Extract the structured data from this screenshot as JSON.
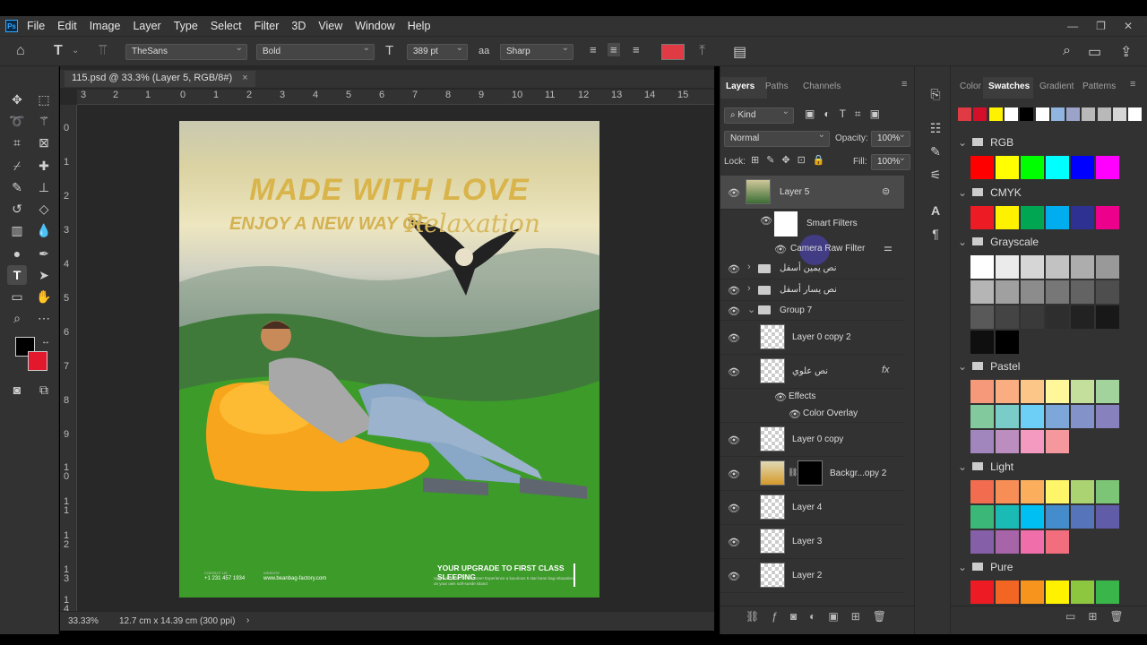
{
  "menu": {
    "logo": "Ps",
    "items": [
      "File",
      "Edit",
      "Image",
      "Layer",
      "Type",
      "Select",
      "Filter",
      "3D",
      "View",
      "Window",
      "Help"
    ]
  },
  "options": {
    "font_family": "TheSans",
    "font_style": "Bold",
    "font_size": "389 pt",
    "anti_alias_icon": "aa",
    "anti_alias": "Sharp",
    "text_color": "#e03a44"
  },
  "document": {
    "tab_title": "115.psd @ 33.3% (Layer 5, RGB/8#)",
    "ruler_h": [
      "3",
      "2",
      "1",
      "0",
      "1",
      "2",
      "3",
      "4",
      "5",
      "6",
      "7",
      "8",
      "9",
      "10",
      "11",
      "12",
      "13",
      "14",
      "15"
    ],
    "ruler_v": [
      "0",
      "1",
      "2",
      "3",
      "4",
      "5",
      "6",
      "7",
      "8",
      "9",
      "1 0",
      "1 1",
      "1 2",
      "1 3",
      "1 4"
    ],
    "zoom": "33.33%",
    "doc_size": "12.7 cm x 14.39 cm (300 ppi)"
  },
  "artwork": {
    "headline": "MADE WITH LOVE",
    "subline": "ENJOY A NEW WAY OF",
    "script_word": "Relaxation",
    "tagline": "YOUR UPGRADE TO FIRST CLASS SLEEPING",
    "blurb": "Upgrade your comfort zone! Experience a luxurious 5 star bean bag relaxation on your own soft-suede island",
    "contact_label": "CONTACT US",
    "phone": "+1 231 457 1934",
    "website_label": "WEBSITE",
    "website": "www.beanbag-factory.com"
  },
  "layers_panel": {
    "tabs": [
      "Layers",
      "Paths",
      "Channels"
    ],
    "kind": "Kind",
    "blend_mode": "Normal",
    "opacity_label": "Opacity:",
    "opacity": "100%",
    "lock_label": "Lock:",
    "fill_label": "Fill:",
    "fill": "100%",
    "layers": {
      "layer5": "Layer 5",
      "smart_filters": "Smart Filters",
      "camera_raw": "Camera Raw Filter",
      "group_right": "نص يمين أسفل",
      "group_left": "نص يسار أسفل",
      "group7": "Group 7",
      "layer0copy2": "Layer 0 copy 2",
      "text_top": "نص علوي",
      "fx": "fx",
      "effects": "Effects",
      "color_overlay": "Color Overlay",
      "layer0copy": "Layer 0 copy",
      "bg_copy2": "Backgr...opy 2",
      "layer4": "Layer 4",
      "layer3": "Layer 3",
      "layer2": "Layer 2"
    }
  },
  "swatches_panel": {
    "tabs": [
      "Color",
      "Swatches",
      "Gradient",
      "Patterns"
    ],
    "recent": [
      "#e03a44",
      "#d40f2a",
      "#fff200",
      "#ffffff",
      "#000000",
      "#ffffff",
      "#8fb5e0",
      "#9ba4c8",
      "#b9b9b9",
      "#b9b9b9",
      "#d6d6d6",
      "#ffffff"
    ],
    "groups": {
      "rgb": {
        "name": "RGB",
        "colors": [
          "#ff0000",
          "#ffff00",
          "#00ff00",
          "#00ffff",
          "#0000ff",
          "#ff00ff"
        ]
      },
      "cmyk": {
        "name": "CMYK",
        "colors": [
          "#ed1c24",
          "#fff200",
          "#00a651",
          "#00aeef",
          "#2e3192",
          "#ec008c"
        ]
      },
      "grayscale": {
        "name": "Grayscale",
        "colors": [
          "#ffffff",
          "#ebebeb",
          "#d6d6d6",
          "#c2c2c2",
          "#adadad",
          "#999999",
          "#b5b5b5",
          "#a0a0a0",
          "#8c8c8c",
          "#777777",
          "#636363",
          "#4e4e4e",
          "#595959",
          "#444444",
          "#3a3a3a",
          "#2e2e2e",
          "#222222",
          "#181818",
          "#0f0f0f",
          "#000000"
        ]
      },
      "pastel": {
        "name": "Pastel",
        "colors": [
          "#f6987a",
          "#f9ad81",
          "#fdc689",
          "#fff799",
          "#c4df9b",
          "#a3d39c",
          "#82ca9d",
          "#7accc8",
          "#6dcff6",
          "#7da7d9",
          "#8393ca",
          "#8781bd",
          "#a186be",
          "#bc8dbf",
          "#f49ac1",
          "#f5989d"
        ]
      },
      "light": {
        "name": "Light",
        "colors": [
          "#f26c4f",
          "#f68e56",
          "#fbaf5d",
          "#fff568",
          "#acd372",
          "#7cc576",
          "#3bb878",
          "#1abbb4",
          "#00bff3",
          "#448ccb",
          "#5574b9",
          "#605ca8",
          "#8560a8",
          "#a864a8",
          "#f06eaa",
          "#f26d7d"
        ]
      },
      "pure": {
        "name": "Pure",
        "colors": [
          "#ed1c24",
          "#f26522",
          "#f7941d",
          "#fff200",
          "#8dc63f",
          "#39b54a"
        ]
      }
    }
  }
}
